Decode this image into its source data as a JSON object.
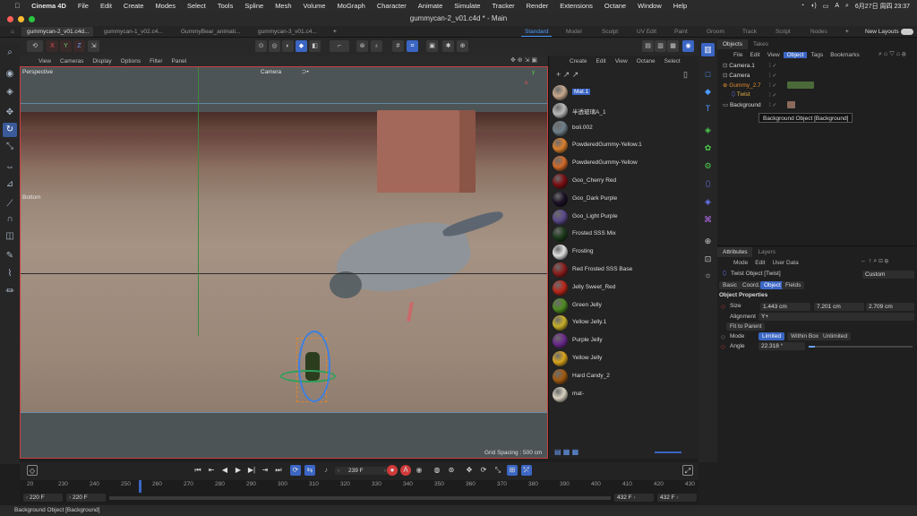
{
  "menubar": {
    "app": "Cinema 4D",
    "items": [
      "File",
      "Edit",
      "Create",
      "Modes",
      "Select",
      "Tools",
      "Spline",
      "Mesh",
      "Volume",
      "MoGraph",
      "Character",
      "Animate",
      "Simulate",
      "Tracker",
      "Render",
      "Extensions",
      "Octane",
      "Window",
      "Help"
    ],
    "datetime": "6月27日 周四  23:37"
  },
  "window": {
    "title": "gummycan-2_v01.c4d * - Main"
  },
  "doc_tabs": [
    "gummycan-2_v01.c4d...",
    "gummycan-1_v02.c4...",
    "GummyBear_animati...",
    "gummycan-3_v01.c4..."
  ],
  "layouts": [
    "Standard",
    "Model",
    "Sculpt",
    "UV Edit",
    "Paint",
    "Groom",
    "Track",
    "Script",
    "Nodes"
  ],
  "new_layouts": "New Layouts",
  "axis_buttons": [
    "X",
    "Y",
    "Z"
  ],
  "viewport": {
    "menu": [
      "View",
      "Cameras",
      "Display",
      "Options",
      "Filter",
      "Panel"
    ],
    "label_perspective": "Perspective",
    "label_camera": "Camera",
    "label_bottom": "Bottom",
    "grid_spacing": "Grid Spacing : 500 cm",
    "axis_x": "x",
    "axis_y": "y"
  },
  "materials": {
    "menu": [
      "Create",
      "Edit",
      "View",
      "Octane",
      "Select"
    ],
    "items": [
      {
        "name": "Mat.1",
        "color": "#c8a98f"
      },
      {
        "name": "半透玻璃A_1",
        "color": "#b9b9b9"
      },
      {
        "name": "boli.002",
        "color": "#6f7f8a"
      },
      {
        "name": "PowderedGummy-Yellow.1",
        "color": "#d8802e"
      },
      {
        "name": "PowderedGummy-Yellow",
        "color": "#d06a2a"
      },
      {
        "name": "Goo_Cherry Red",
        "color": "#7a0f14"
      },
      {
        "name": "Goo_Dark Purple",
        "color": "#1a1025"
      },
      {
        "name": "Goo_Light Purple",
        "color": "#5a4a8a"
      },
      {
        "name": "Frosted SSS Mix",
        "color": "#1c3a1c"
      },
      {
        "name": "Frosting",
        "color": "#e0e0e0"
      },
      {
        "name": "Red Frosted SSS Base",
        "color": "#8a1e1e"
      },
      {
        "name": "Jelly Sweet_Red",
        "color": "#b8281c"
      },
      {
        "name": "Green Jelly",
        "color": "#4f8a22"
      },
      {
        "name": "Yellow Jelly.1",
        "color": "#c8b02a"
      },
      {
        "name": "Purple Jelly",
        "color": "#6a2a8a"
      },
      {
        "name": "Yellow Jelly",
        "color": "#d8a51e"
      },
      {
        "name": "Hard Candy_2",
        "color": "#a05a12"
      },
      {
        "name": "mat-",
        "color": "#d8d0c0"
      }
    ]
  },
  "object_manager": {
    "tabs": [
      "Objects",
      "Takes"
    ],
    "menu": [
      "File",
      "Edit",
      "View",
      "Object",
      "Tags",
      "Bookmarks"
    ],
    "objects": [
      {
        "name": "Camera.1",
        "color": "#dcdcdc"
      },
      {
        "name": "Camera",
        "color": "#dcdcdc"
      },
      {
        "name": "Gummy_2.7",
        "color": "#e08a2e"
      },
      {
        "name": "Twist",
        "color": "#e0b04a"
      },
      {
        "name": "Background",
        "color": "#dcdcdc"
      }
    ],
    "tooltip": "Background Object [Background]"
  },
  "attributes": {
    "tabs": [
      "Attributes",
      "Layers"
    ],
    "menu": [
      "Mode",
      "Edit",
      "User Data"
    ],
    "object_title": "Twist Object [Twist]",
    "preset": "Custom",
    "subtabs": [
      "Basic",
      "Coord.",
      "Object",
      "Fields"
    ],
    "section": "Object Properties",
    "size_label": "Size",
    "size_values": [
      "1.443 cm",
      "7.201 cm",
      "2.709 cm"
    ],
    "alignment_label": "Alignment",
    "alignment_value": "Y+",
    "fit_button": "Fit to Parent",
    "mode_label": "Mode",
    "mode_options": [
      "Limited",
      "Within Box",
      "Unlimited"
    ],
    "angle_label": "Angle",
    "angle_value": "22.318 °",
    "angle_fraction": 0.06
  },
  "timeline": {
    "current_frame": "239 F",
    "ticks": [
      "20",
      "230",
      "240",
      "250",
      "260",
      "270",
      "280",
      "290",
      "300",
      "310",
      "320",
      "330",
      "340",
      "350",
      "360",
      "370",
      "380",
      "390",
      "400",
      "410",
      "420",
      "430"
    ],
    "range_start": "220 F",
    "range_start2": "220 F",
    "range_end": "432 F",
    "range_end2": "432 F"
  },
  "status": "Background Object [Background]"
}
